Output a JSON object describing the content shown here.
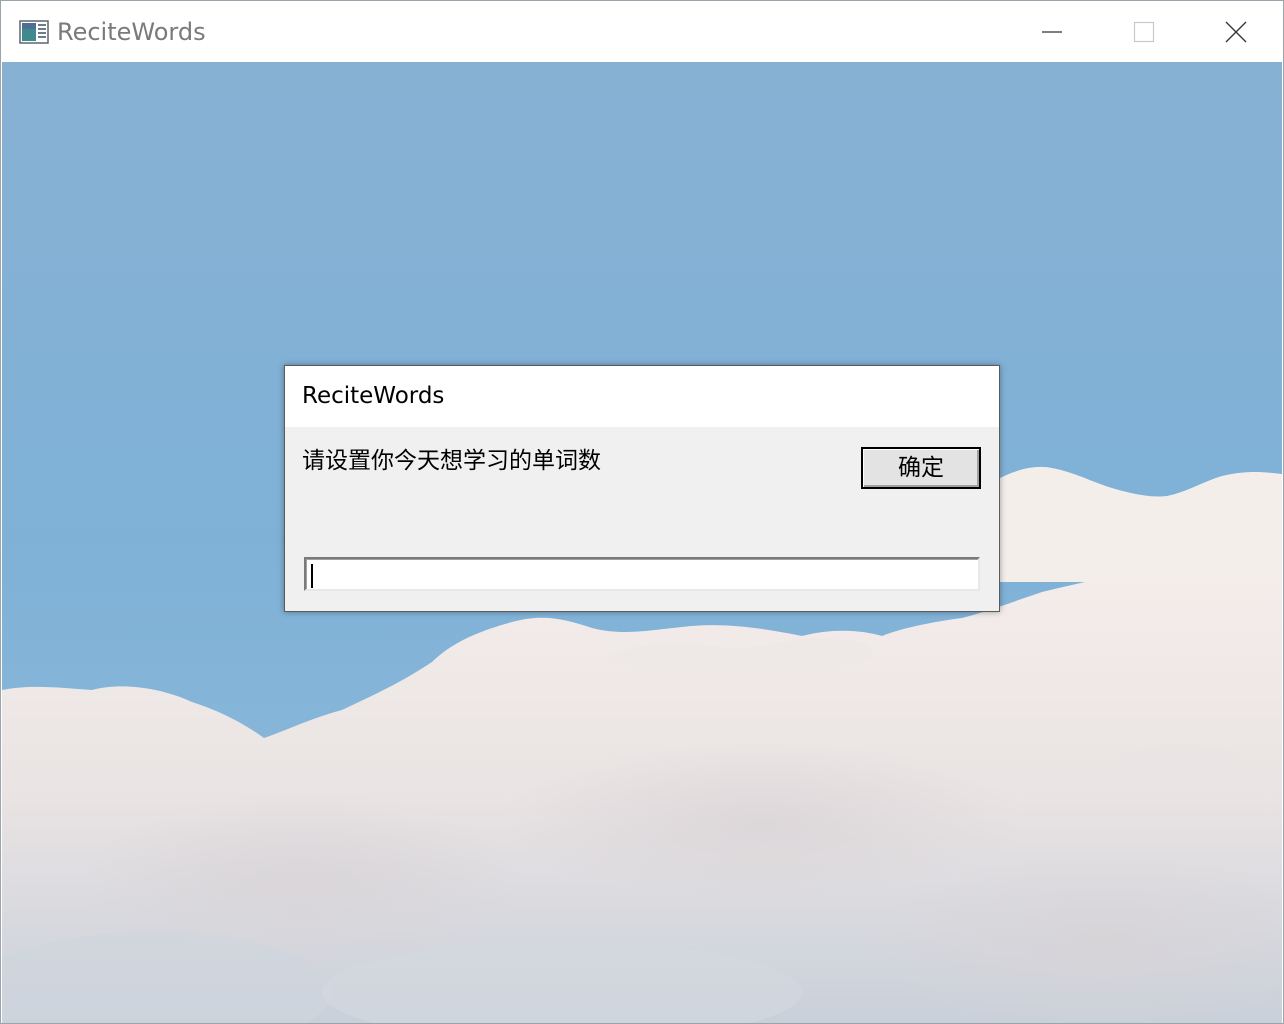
{
  "window": {
    "title": "ReciteWords",
    "icon": "app-window-icon",
    "controls": [
      "minimize-icon",
      "maximize-icon",
      "close-icon"
    ]
  },
  "dialog": {
    "title": "ReciteWords",
    "prompt": "请设置你今天想学习的单词数",
    "ok_label": "确定",
    "input_value": "",
    "input_placeholder": ""
  },
  "colors": {
    "sky_top": "#86b1d4",
    "sky_mid": "#7eb0d6",
    "cloud": "#f3ecea",
    "dialog_bg": "#f0f0f0",
    "title_text": "#7a7a7a"
  }
}
